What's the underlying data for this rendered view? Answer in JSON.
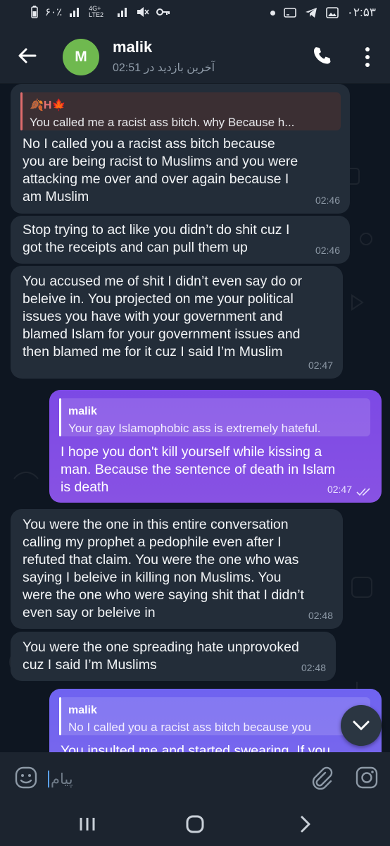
{
  "status_bar": {
    "left_text": "۶۰٪",
    "network_label": "4G+ LTE2",
    "clock": "۰۲:۵۳"
  },
  "header": {
    "avatar_letter": "M",
    "name": "malik",
    "last_seen": "آخرین بازدید در 02:51"
  },
  "messages": [
    {
      "direction": "incoming",
      "reply_name": "🍂H🍁",
      "reply_text": "You called me a racist ass bitch.  why  Because h...",
      "lines": [
        "No I called you a racist ass bitch because",
        "you are being racist to Muslims and you were",
        "attacking me over and over again because I",
        "am Muslim"
      ],
      "time": "02:46"
    },
    {
      "direction": "incoming",
      "lines": [
        "Stop trying to act like you didn’t do shit cuz I",
        "got the receipts and can pull them up"
      ],
      "time": "02:46"
    },
    {
      "direction": "incoming",
      "lines": [
        "You accused me of shit I didn’t even say do or",
        "beleive in. You projected on me your political",
        "issues you have with your government and",
        "blamed Islam for your government issues and",
        "then blamed me for it cuz I said I’m Muslim"
      ],
      "time": "02:47"
    },
    {
      "direction": "outgoing",
      "reply_name": "malik",
      "reply_text": "Your gay Islamophobic ass is extremely hateful.",
      "lines": [
        "I hope you don't kill yourself while kissing a",
        "man.  Because the sentence of death in Islam",
        "is death"
      ],
      "time": "02:47",
      "status": "read"
    },
    {
      "direction": "incoming",
      "lines": [
        "You were the one in this entire conversation",
        "calling my prophet a pedophile even after I",
        "refuted that claim. You were the one who was",
        "saying I beleive in killing non Muslims. You",
        "were the one who were saying shit that I didn’t",
        "even say or beleive in"
      ],
      "time": "02:48"
    },
    {
      "direction": "incoming",
      "lines": [
        "You were the one spreading hate unprovoked",
        "cuz I said I’m Muslims"
      ],
      "time": "02:48"
    },
    {
      "direction": "outgoing",
      "reply_name": "malik",
      "reply_text": "No I called you a racist ass bitch because you",
      "lines": [
        "You insulted me and started swearing.  If you"
      ]
    }
  ],
  "input": {
    "placeholder": "پیام"
  },
  "colors": {
    "background": "#0e1621",
    "header": "#1c242f",
    "incoming_bubble": "#232d39",
    "outgoing_bubble": "#7c49e5",
    "avatar": "#6fb94f",
    "accent": "#8a5cf6"
  },
  "icons": {
    "back": "arrow-left-icon",
    "call": "phone-icon",
    "menu": "more-vert-icon",
    "emoji": "smile-icon",
    "attach": "paperclip-icon",
    "camera": "instagram-camera-icon",
    "scroll": "chevron-down-icon"
  }
}
